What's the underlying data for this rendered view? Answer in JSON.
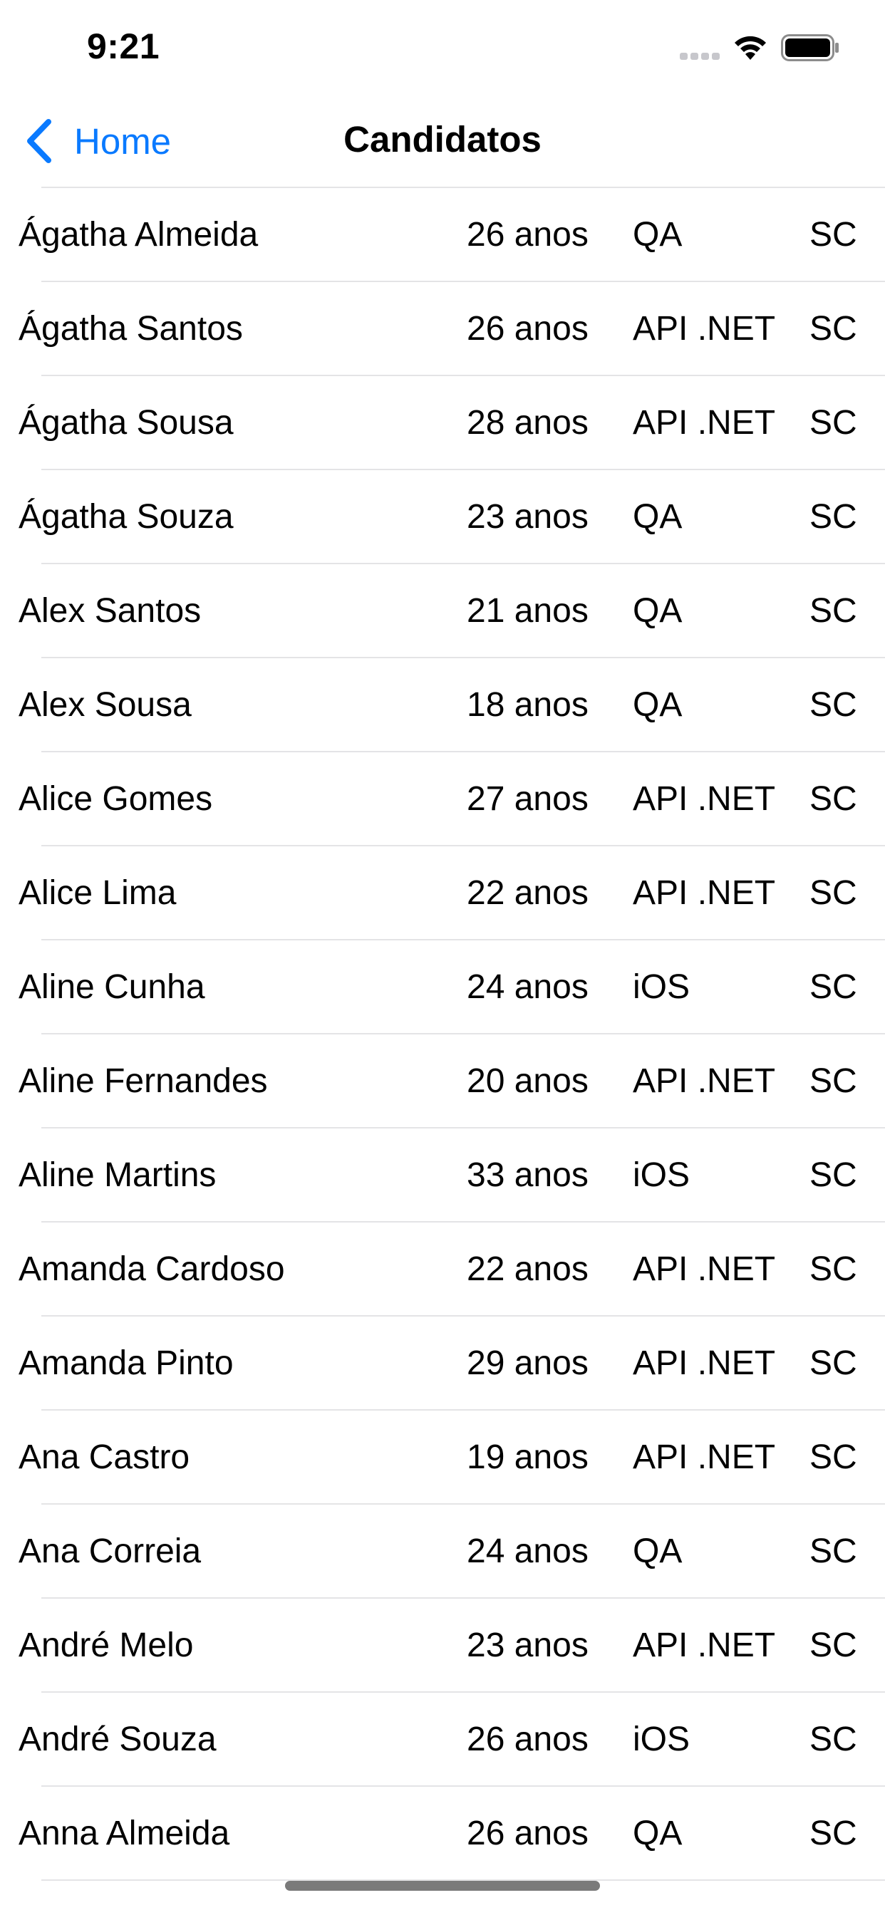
{
  "status_bar": {
    "time": "9:21",
    "icons": [
      "cellular-signal-icon",
      "wifi-icon",
      "battery-icon"
    ]
  },
  "nav": {
    "back_label": "Home",
    "title": "Candidatos",
    "accent_color": "#0a7aff"
  },
  "candidates": [
    {
      "name": "Ágatha Almeida",
      "age": "26 anos",
      "role": "QA",
      "state": "SC"
    },
    {
      "name": "Ágatha Santos",
      "age": "26 anos",
      "role": "API .NET",
      "state": "SC"
    },
    {
      "name": "Ágatha Sousa",
      "age": "28 anos",
      "role": "API .NET",
      "state": "SC"
    },
    {
      "name": "Ágatha Souza",
      "age": "23 anos",
      "role": "QA",
      "state": "SC"
    },
    {
      "name": "Alex Santos",
      "age": "21 anos",
      "role": "QA",
      "state": "SC"
    },
    {
      "name": "Alex Sousa",
      "age": "18 anos",
      "role": "QA",
      "state": "SC"
    },
    {
      "name": "Alice Gomes",
      "age": "27 anos",
      "role": "API .NET",
      "state": "SC"
    },
    {
      "name": "Alice Lima",
      "age": "22 anos",
      "role": "API .NET",
      "state": "SC"
    },
    {
      "name": "Aline Cunha",
      "age": "24 anos",
      "role": "iOS",
      "state": "SC"
    },
    {
      "name": "Aline Fernandes",
      "age": "20 anos",
      "role": "API .NET",
      "state": "SC"
    },
    {
      "name": "Aline Martins",
      "age": "33 anos",
      "role": "iOS",
      "state": "SC"
    },
    {
      "name": "Amanda Cardoso",
      "age": "22 anos",
      "role": "API .NET",
      "state": "SC"
    },
    {
      "name": "Amanda Pinto",
      "age": "29 anos",
      "role": "API .NET",
      "state": "SC"
    },
    {
      "name": "Ana Castro",
      "age": "19 anos",
      "role": "API .NET",
      "state": "SC"
    },
    {
      "name": "Ana Correia",
      "age": "24 anos",
      "role": "QA",
      "state": "SC"
    },
    {
      "name": "André Melo",
      "age": "23 anos",
      "role": "API .NET",
      "state": "SC"
    },
    {
      "name": "André Souza",
      "age": "26 anos",
      "role": "iOS",
      "state": "SC"
    },
    {
      "name": "Anna Almeida",
      "age": "26 anos",
      "role": "QA",
      "state": "SC"
    }
  ]
}
